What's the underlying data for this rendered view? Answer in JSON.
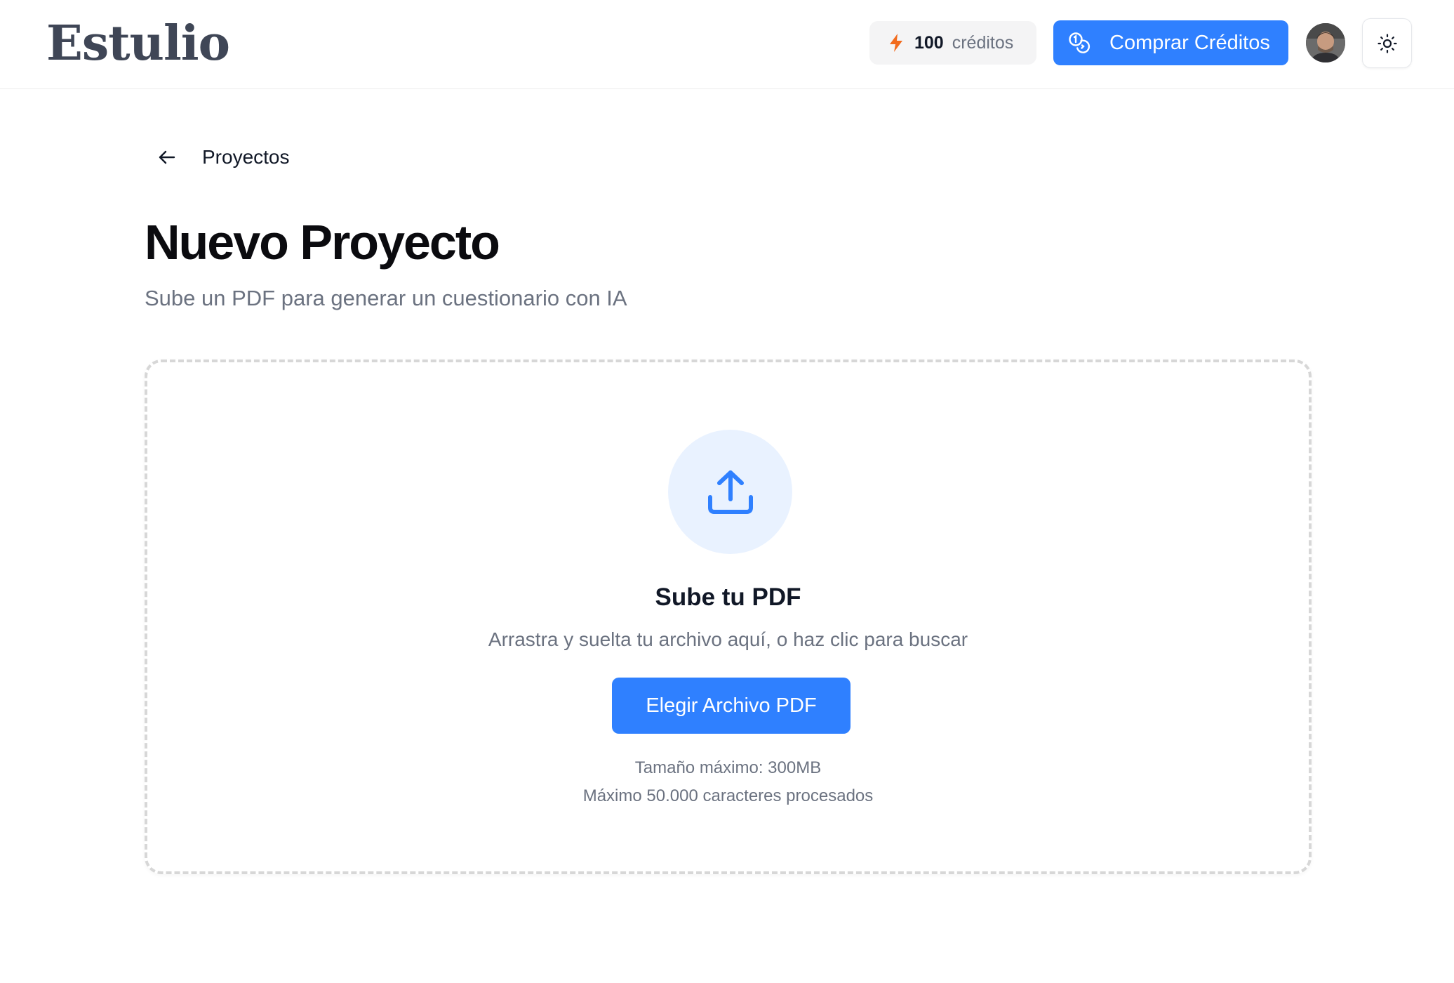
{
  "header": {
    "logo": "Estulio",
    "credits": {
      "count": "100",
      "unit": "créditos",
      "icon": "bolt-icon"
    },
    "buy_button": {
      "label": "Comprar Créditos",
      "icon": "coins-icon"
    },
    "avatar_icon": "user-avatar",
    "theme_toggle_icon": "sun-icon"
  },
  "nav": {
    "back_label": "Proyectos",
    "back_icon": "arrow-left-icon"
  },
  "page": {
    "title": "Nuevo Proyecto",
    "subtitle": "Sube un PDF para generar un cuestionario con IA"
  },
  "upload": {
    "icon": "upload-icon",
    "title": "Sube tu PDF",
    "hint": "Arrastra y suelta tu archivo aquí, o haz clic para buscar",
    "button_label": "Elegir Archivo PDF",
    "max_size_note": "Tamaño máximo: 300MB",
    "max_chars_note": "Máximo 50.000 caracteres procesados"
  },
  "colors": {
    "accent": "#2f80ff",
    "bolt": "#f26b1d",
    "upload_circle_bg": "#e9f2ff",
    "muted_text": "#6b7280"
  }
}
